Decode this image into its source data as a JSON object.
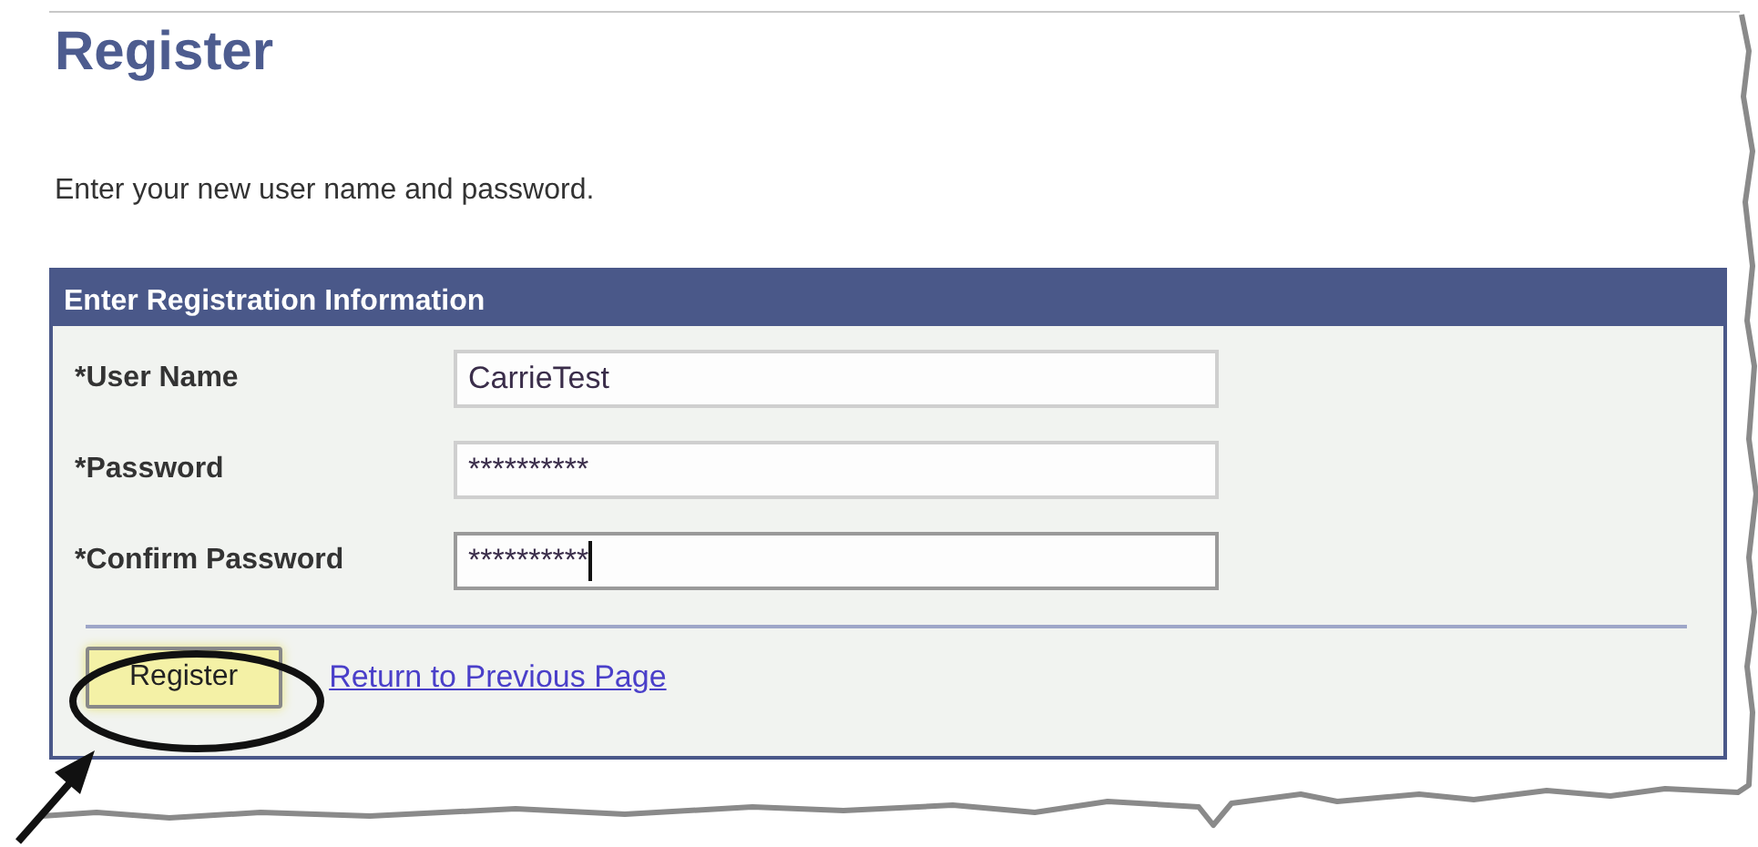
{
  "page": {
    "title": "Register",
    "instruction": "Enter your new user name and password."
  },
  "panel": {
    "header": "Enter Registration Information",
    "fields": [
      {
        "label": "*User Name",
        "value": "CarrieTest",
        "focused": false
      },
      {
        "label": "*Password",
        "value": "**********",
        "focused": false
      },
      {
        "label": "*Confirm Password",
        "value": "**********",
        "focused": true
      }
    ],
    "register_button": {
      "label": "Register",
      "highlighted": true
    },
    "return_link": "Return to Previous Page"
  }
}
